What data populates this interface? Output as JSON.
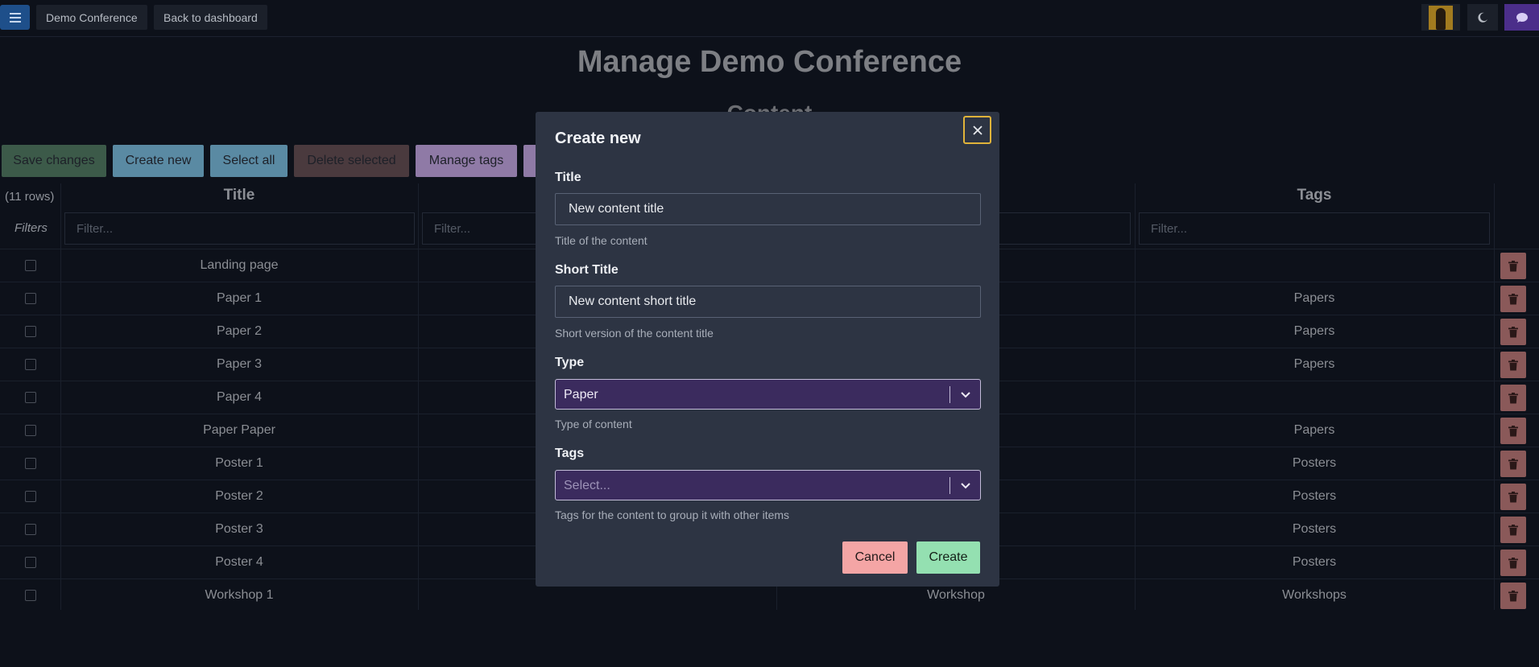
{
  "topbar": {
    "conference_label": "Demo Conference",
    "back_label": "Back to dashboard"
  },
  "header": {
    "title": "Manage Demo Conference",
    "section": "Content"
  },
  "toolbar": {
    "save_label": "Save changes",
    "create_label": "Create new",
    "select_all_label": "Select all",
    "delete_selected_label": "Delete selected",
    "manage_tags_label": "Manage tags"
  },
  "table": {
    "row_count": "(11 rows)",
    "filters_label": "Filters",
    "filter_placeholder": "Filter...",
    "columns": [
      "Title",
      "Tags"
    ],
    "rows": [
      {
        "title": "Landing page",
        "type": "",
        "tags": ""
      },
      {
        "title": "Paper 1",
        "type": "",
        "tags": "Papers"
      },
      {
        "title": "Paper 2",
        "type": "",
        "tags": "Papers"
      },
      {
        "title": "Paper 3",
        "type": "",
        "tags": "Papers"
      },
      {
        "title": "Paper 4",
        "type": "",
        "tags": ""
      },
      {
        "title": "Paper Paper",
        "type": "",
        "tags": "Papers"
      },
      {
        "title": "Poster 1",
        "type": "",
        "tags": "Posters"
      },
      {
        "title": "Poster 2",
        "type": "",
        "tags": "Posters"
      },
      {
        "title": "Poster 3",
        "type": "",
        "tags": "Posters"
      },
      {
        "title": "Poster 4",
        "type": "",
        "tags": "Posters"
      },
      {
        "title": "Workshop 1",
        "type": "Workshop",
        "tags": "Workshops"
      }
    ]
  },
  "modal": {
    "title": "Create new",
    "fields": {
      "title": {
        "label": "Title",
        "value": "New content title",
        "helper": "Title of the content"
      },
      "short_title": {
        "label": "Short Title",
        "value": "New content short title",
        "helper": "Short version of the content title"
      },
      "type": {
        "label": "Type",
        "value": "Paper",
        "helper": "Type of content"
      },
      "tags": {
        "label": "Tags",
        "placeholder": "Select...",
        "helper": "Tags for the content to group it with other items"
      }
    },
    "cancel_label": "Cancel",
    "create_label": "Create"
  },
  "colors": {
    "background": "#0d111a",
    "modal": "#2d3443",
    "select": "#3b2b5e",
    "cancel": "#f4a5a5",
    "create": "#94e0b1",
    "focus": "#e0b33a"
  },
  "icons": {
    "menu": "hamburger-icon",
    "theme": "moon-icon",
    "chat": "chat-bubble-icon",
    "delete": "trash-icon",
    "close": "close-icon",
    "chevron": "chevron-down-icon"
  }
}
